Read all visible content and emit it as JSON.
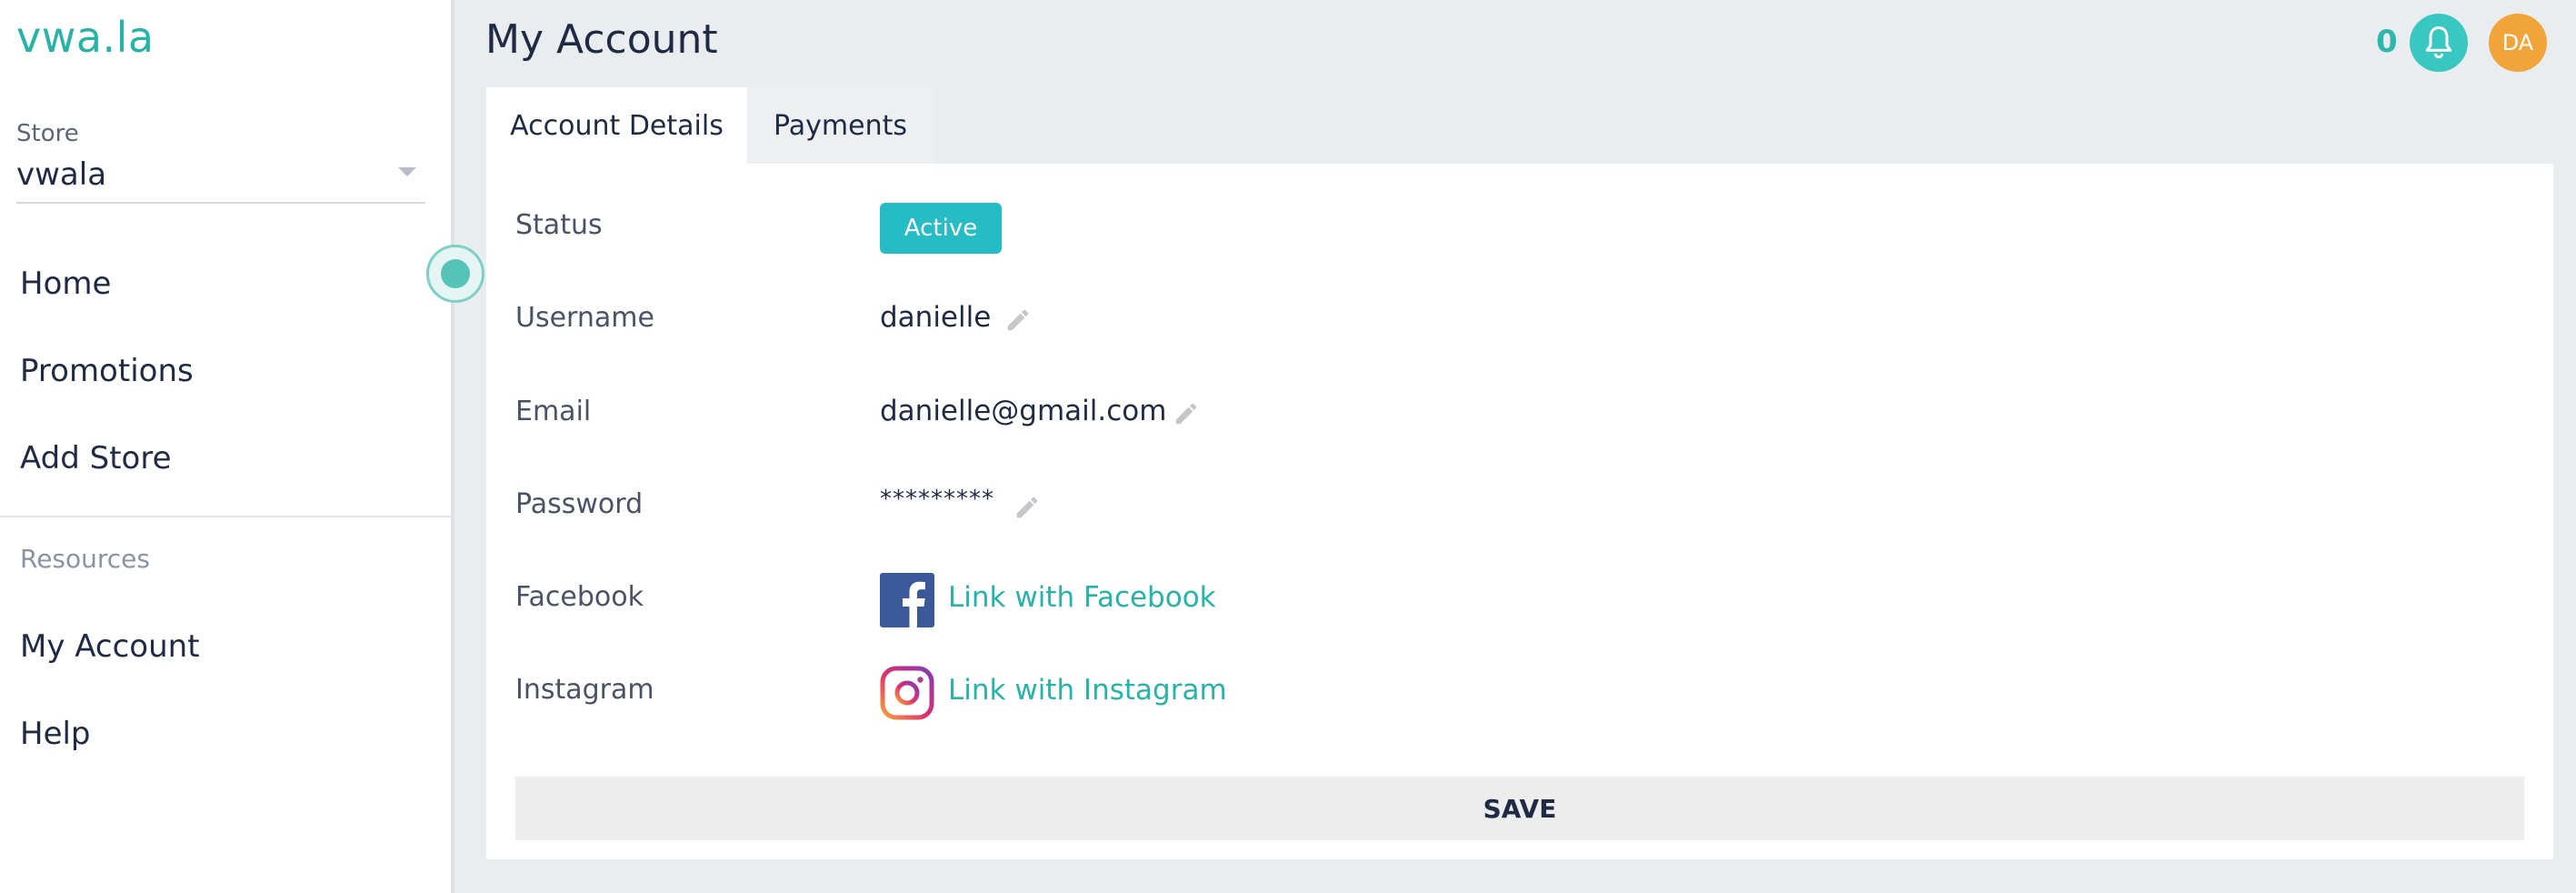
{
  "app": {
    "logo": "vwa.la"
  },
  "sidebar": {
    "store_label": "Store",
    "store_value": "vwala",
    "items": [
      {
        "label": "Home"
      },
      {
        "label": "Promotions"
      },
      {
        "label": "Add Store"
      }
    ],
    "section_title": "Resources",
    "resource_items": [
      {
        "label": "My Account"
      },
      {
        "label": "Help"
      }
    ]
  },
  "header": {
    "title": "My Account",
    "notification_count": "0",
    "avatar_initials": "DA"
  },
  "tabs": [
    {
      "label": "Account Details",
      "active": true
    },
    {
      "label": "Payments",
      "active": false
    }
  ],
  "account": {
    "status": {
      "label": "Status",
      "value": "Active"
    },
    "username": {
      "label": "Username",
      "value": "danielle"
    },
    "email": {
      "label": "Email",
      "value": "danielle@gmail.com"
    },
    "password": {
      "label": "Password",
      "value": "*********"
    },
    "facebook": {
      "label": "Facebook",
      "link": "Link with Facebook"
    },
    "instagram": {
      "label": "Instagram",
      "link": "Link with Instagram"
    }
  },
  "actions": {
    "save_label": "SAVE"
  },
  "colors": {
    "accent": "#26b3a8",
    "status_badge": "#26bcc6",
    "bell": "#39c8c1",
    "avatar": "#f0a43a",
    "facebook": "#3b5998"
  },
  "icons": {
    "notifications": "bell-icon",
    "edit": "pencil-icon",
    "facebook": "facebook-icon",
    "instagram": "instagram-icon",
    "store_dropdown": "chevron-down-icon"
  }
}
